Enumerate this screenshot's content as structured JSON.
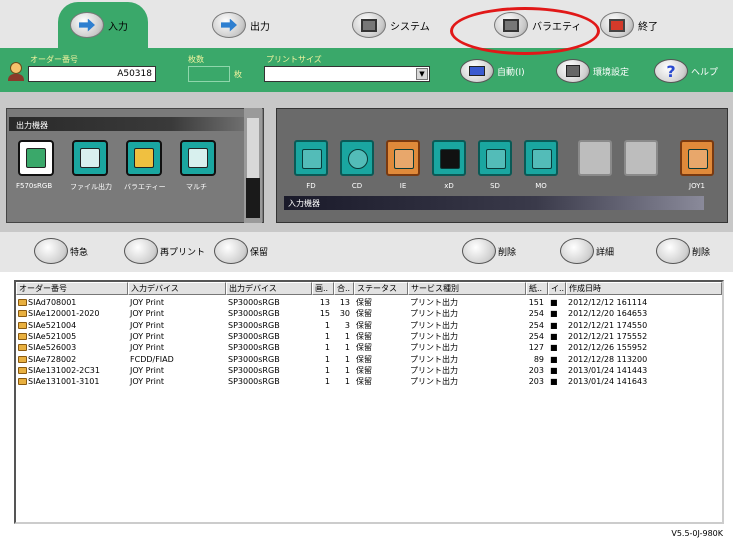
{
  "top_tabs": [
    {
      "name": "input",
      "label": "入力"
    },
    {
      "name": "output",
      "label": "出力"
    },
    {
      "name": "system",
      "label": "システム"
    },
    {
      "name": "variety",
      "label": "バラエティ"
    },
    {
      "name": "exit",
      "label": "終了"
    }
  ],
  "order_bar": {
    "order_no_label": "オーダー番号",
    "order_no_value": "A50318",
    "copies_label": "枚数",
    "copies_unit": "枚",
    "print_size_label": "プリントサイズ",
    "print_size_value": "",
    "auto_label": "自動(I)",
    "env_label": "環境設定",
    "help_label": "ヘルプ"
  },
  "output_panel": {
    "title": "出力機器",
    "devices": [
      {
        "label": "F570sRGB",
        "icon": "printer-icon",
        "color": "#ffffff"
      },
      {
        "label": "ファイル出力",
        "icon": "file-output-icon",
        "color": "#1aa6a0"
      },
      {
        "label": "バラエティー",
        "icon": "variety-icon",
        "color": "#1aa6a0"
      },
      {
        "label": "マルチ",
        "icon": "multi-icon",
        "color": "#1aa6a0"
      }
    ]
  },
  "input_panel": {
    "title": "入力機器",
    "devices": [
      {
        "label": "FD",
        "style": "teal",
        "icon": "floppy-icon"
      },
      {
        "label": "CD",
        "style": "teal",
        "icon": "cd-icon"
      },
      {
        "label": "IE",
        "style": "orange",
        "icon": "ie-icon"
      },
      {
        "label": "xD",
        "style": "teal",
        "icon": "xd-card-icon"
      },
      {
        "label": "SD",
        "style": "teal",
        "icon": "sd-card-icon"
      },
      {
        "label": "MO",
        "style": "teal",
        "icon": "mo-disk-icon"
      },
      {
        "label": "",
        "style": "empty",
        "icon": "empty-slot-icon"
      },
      {
        "label": "",
        "style": "empty",
        "icon": "empty-slot-icon"
      },
      {
        "label": "JOY1",
        "style": "orange",
        "icon": "joy-icon"
      }
    ]
  },
  "actions": {
    "rush": "特急",
    "reprint": "再プリント",
    "hold": "保留",
    "delete_image": "削除",
    "details": "詳細",
    "remove": "削除"
  },
  "list": {
    "columns": [
      "オーダー番号",
      "入力デバイス",
      "出力デバイス",
      "画..",
      "合..",
      "ステータス",
      "サービス種別",
      "紙..",
      "イ..",
      "作成日時"
    ],
    "rows": [
      [
        "SIAd708001",
        "JOY Print",
        "SP3000sRGB",
        "13",
        "13",
        "保留",
        "プリント出力",
        "151",
        "■",
        "2012/12/12 161114"
      ],
      [
        "SIAe120001-2020",
        "JOY Print",
        "SP3000sRGB",
        "15",
        "30",
        "保留",
        "プリント出力",
        "254",
        "■",
        "2012/12/20 164653"
      ],
      [
        "SIAe521004",
        "JOY Print",
        "SP3000sRGB",
        "1",
        "3",
        "保留",
        "プリント出力",
        "254",
        "■",
        "2012/12/21 174550"
      ],
      [
        "SIAe521005",
        "JOY Print",
        "SP3000sRGB",
        "1",
        "1",
        "保留",
        "プリント出力",
        "254",
        "■",
        "2012/12/21 175552"
      ],
      [
        "SIAe526003",
        "JOY Print",
        "SP3000sRGB",
        "1",
        "1",
        "保留",
        "プリント出力",
        "127",
        "■",
        "2012/12/26 155952"
      ],
      [
        "SIAe728002",
        "FCDD/FIAD",
        "SP3000sRGB",
        "1",
        "1",
        "保留",
        "プリント出力",
        "89",
        "■",
        "2012/12/28 113200"
      ],
      [
        "SIAe131002-2C31",
        "JOY Print",
        "SP3000sRGB",
        "1",
        "1",
        "保留",
        "プリント出力",
        "203",
        "■",
        "2013/01/24 141443"
      ],
      [
        "SIAe131001-3101",
        "JOY Print",
        "SP3000sRGB",
        "1",
        "1",
        "保留",
        "プリント出力",
        "203",
        "■",
        "2013/01/24 141643"
      ]
    ]
  },
  "version": "V5.5-0J-980K",
  "colors": {
    "bar_green": "#3aa86a",
    "highlight": "#e11818",
    "folder": "#e8b040"
  }
}
